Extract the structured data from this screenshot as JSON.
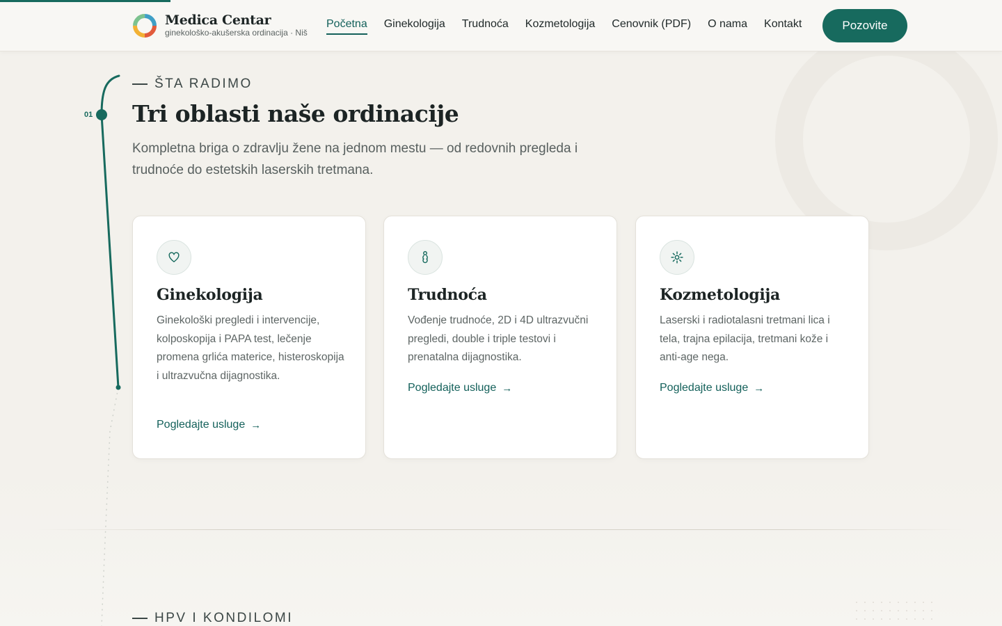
{
  "header": {
    "brand_name": "Medica Centar",
    "brand_sub": "ginekološko-akušerska ordinacija · Niš",
    "nav": [
      {
        "label": "Početna",
        "active": true
      },
      {
        "label": "Ginekologija",
        "active": false
      },
      {
        "label": "Trudnoća",
        "active": false
      },
      {
        "label": "Kozmetologija",
        "active": false
      },
      {
        "label": "Cenovnik (PDF)",
        "active": false
      },
      {
        "label": "O nama",
        "active": false
      },
      {
        "label": "Kontakt",
        "active": false
      }
    ],
    "cta_label": "Pozovite"
  },
  "timeline": {
    "step": "01"
  },
  "section": {
    "eyebrow": "ŠTA RADIMO",
    "title": "Tri oblasti naše ordinacije",
    "lead": "Kompletna briga o zdravlju žene na jednom mestu — od redovnih pregleda i trudnoće do estetskih laserskih tretmana."
  },
  "cards": [
    {
      "icon": "heart-icon",
      "title": "Ginekologija",
      "text": "Ginekološki pregledi i intervencije, kolposkopija i PAPA test, lečenje promena grlića materice, histeroskopija i ultrazvučna dijagnostika.",
      "link": "Pogledajte usluge"
    },
    {
      "icon": "pregnancy-icon",
      "title": "Trudnoća",
      "text": "Vođenje trudnoće, 2D i 4D ultrazvučni pregledi, double i triple testovi i prenatalna dijagnostika.",
      "link": "Pogledajte usluge"
    },
    {
      "icon": "sparkle-icon",
      "title": "Kozmetologija",
      "text": "Laserski i radiotalasni tretmani lica i tela, trajna epilacija, tretmani kože i anti-age nega.",
      "link": "Pogledajte usluge"
    }
  ],
  "next_section": {
    "eyebrow": "HPV I KONDILOMI"
  },
  "colors": {
    "accent": "#176a5e",
    "background": "#f3f1ec",
    "card": "#ffffff"
  }
}
